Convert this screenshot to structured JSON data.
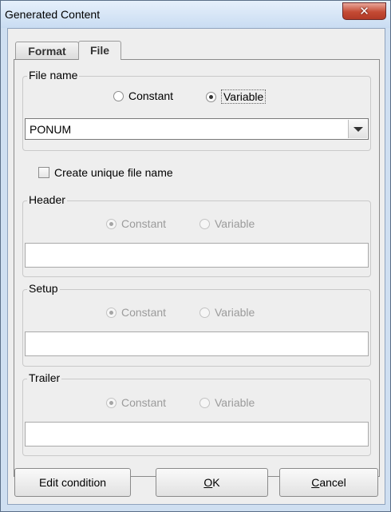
{
  "window": {
    "title": "Generated Content",
    "close_glyph": "✕"
  },
  "tabs": [
    {
      "label": "Format",
      "selected": false
    },
    {
      "label": "File",
      "selected": true
    }
  ],
  "file_name": {
    "legend": "File name",
    "radio_constant": "Constant",
    "radio_variable": "Variable",
    "selected": "Variable",
    "combo_value": "PONUM"
  },
  "unique": {
    "label": "Create unique file name",
    "checked": false
  },
  "header": {
    "legend": "Header",
    "radio_constant": "Constant",
    "radio_variable": "Variable",
    "selected": "Constant",
    "value": ""
  },
  "setup": {
    "legend": "Setup",
    "radio_constant": "Constant",
    "radio_variable": "Variable",
    "selected": "Constant",
    "value": ""
  },
  "trailer": {
    "legend": "Trailer",
    "radio_constant": "Constant",
    "radio_variable": "Variable",
    "selected": "Constant",
    "value": ""
  },
  "buttons": {
    "edit_condition": "Edit condition",
    "ok_mnemonic": "O",
    "ok_rest": "K",
    "cancel_mnemonic": "C",
    "cancel_rest": "ancel"
  },
  "colors": {
    "titlebar": "#c9dcf2",
    "close_button": "#c44a34",
    "dialog_bg": "#eeeeee"
  }
}
